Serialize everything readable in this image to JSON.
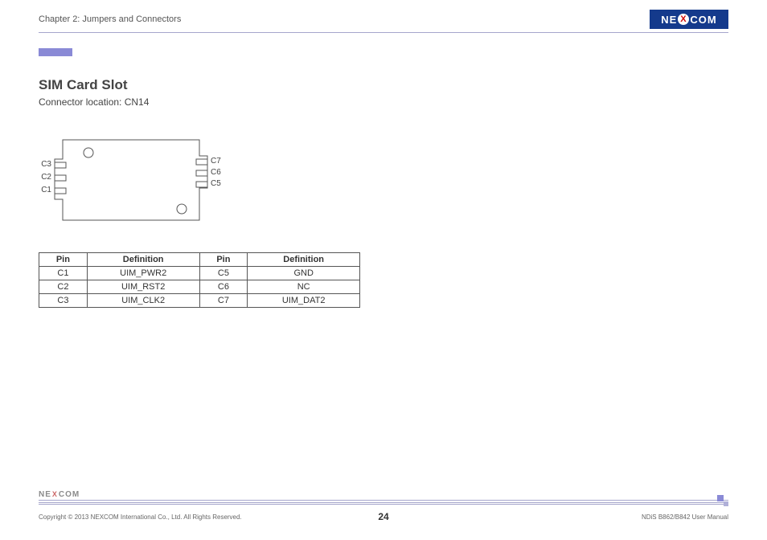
{
  "header": {
    "chapter": "Chapter 2: Jumpers and Connectors",
    "brand": {
      "pre": "NE",
      "x": "X",
      "post": "COM"
    }
  },
  "section": {
    "title": "SIM Card Slot",
    "subtitle": "Connector location: CN14"
  },
  "diagram": {
    "left_pins": [
      "C3",
      "C2",
      "C1"
    ],
    "right_pins": [
      "C7",
      "C6",
      "C5"
    ]
  },
  "table": {
    "headers": {
      "pin": "Pin",
      "def": "Definition"
    },
    "rows": [
      {
        "pin_a": "C1",
        "def_a": "UIM_PWR2",
        "pin_b": "C5",
        "def_b": "GND"
      },
      {
        "pin_a": "C2",
        "def_a": "UIM_RST2",
        "pin_b": "C6",
        "def_b": "NC"
      },
      {
        "pin_a": "C3",
        "def_a": "UIM_CLK2",
        "pin_b": "C7",
        "def_b": "UIM_DAT2"
      }
    ]
  },
  "footer": {
    "brand": {
      "pre": "NE",
      "x": "X",
      "post": "COM"
    },
    "copyright": "Copyright © 2013 NEXCOM International Co., Ltd. All Rights Reserved.",
    "page": "24",
    "manual": "NDiS B862/B842 User Manual"
  }
}
